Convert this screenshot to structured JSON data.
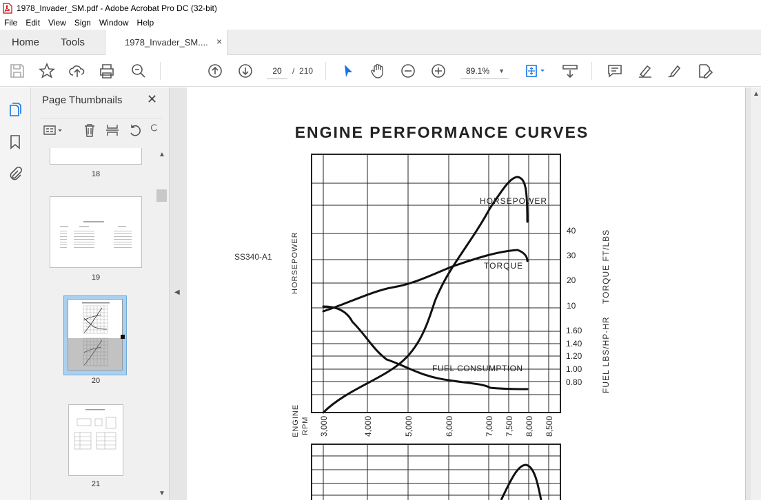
{
  "window": {
    "title": "1978_Invader_SM.pdf - Adobe Acrobat Pro DC (32-bit)"
  },
  "menu": [
    "File",
    "Edit",
    "View",
    "Sign",
    "Window",
    "Help"
  ],
  "tabs": {
    "home": "Home",
    "tools": "Tools",
    "document": "1978_Invader_SM....",
    "close": "×"
  },
  "toolbar": {
    "icons": [
      "save-icon",
      "star-icon",
      "upload-icon",
      "print-icon",
      "zoom-search-icon",
      "page-up-icon",
      "page-down-icon",
      "select-arrow-icon",
      "hand-icon",
      "zoom-out-icon",
      "zoom-in-icon",
      "fit-page-icon",
      "scroll-mode-icon",
      "comment-icon",
      "highlight-icon",
      "sign-icon",
      "edit-pdf-icon"
    ],
    "current_page": "20",
    "page_separator": "/",
    "total_pages": "210",
    "zoom": "89.1%"
  },
  "panel": {
    "title": "Page Thumbnails",
    "close": "✕",
    "thumbnails": [
      {
        "label": "18"
      },
      {
        "label": "19"
      },
      {
        "label": "20",
        "selected": true
      },
      {
        "label": "21"
      }
    ]
  },
  "document": {
    "heading": "ENGINE PERFORMANCE CURVES",
    "model": "SS340-A1",
    "left_axis": "HORSEPOWER",
    "right_axis_top": "TORQUE FT/LBS",
    "right_axis_bottom": "FUEL LBS/HP-HR",
    "bottom_axis": [
      "ENGINE",
      "RPM"
    ],
    "curve_labels": [
      "HORSEPOWER",
      "TORQUE",
      "FUEL CONSUMPTION"
    ],
    "torque_ticks": [
      "40",
      "30",
      "20",
      "10"
    ],
    "fuel_ticks": [
      "1.60",
      "1.40",
      "1.20",
      "1.00",
      "0.80"
    ],
    "rpm_ticks": [
      "3,000",
      "4,000",
      "5,000",
      "6,000",
      "7,000",
      "7,500",
      "8,000",
      "8,500"
    ]
  },
  "colors": {
    "accent": "#1473e6",
    "toolbar_bg": "#ffffff",
    "tab_bg": "#eeeeee",
    "panel_bg": "#f0f0f0",
    "viewer_bg": "#e6e6e6"
  }
}
